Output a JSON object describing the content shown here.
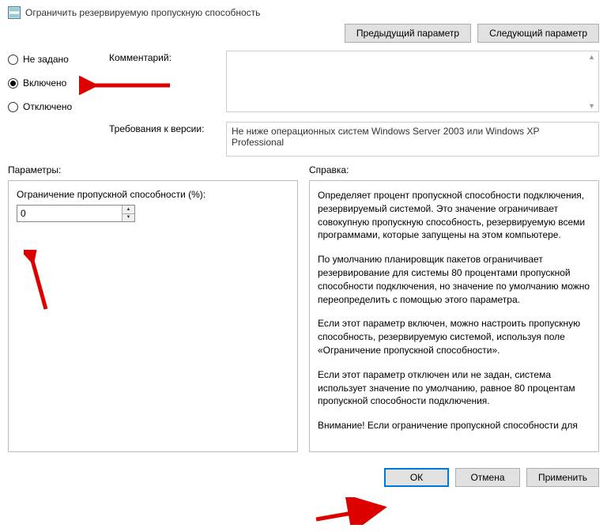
{
  "title": "Ограничить резервируемую пропускную способность",
  "nav": {
    "prev": "Предыдущий параметр",
    "next": "Следующий параметр"
  },
  "radios": {
    "not_configured": "Не задано",
    "enabled": "Включено",
    "disabled": "Отключено",
    "selected": "enabled"
  },
  "comment_label": "Комментарий:",
  "requirements_label": "Требования к версии:",
  "requirements_text": "Не ниже операционных систем Windows Server 2003 или Windows XP Professional",
  "options_label": "Параметры:",
  "help_label": "Справка:",
  "bandwidth_label": "Ограничение пропускной способности (%):",
  "bandwidth_value": "0",
  "help_paragraphs": [
    "Определяет процент пропускной способности подключения, резервируемый системой. Это значение ограничивает совокупную пропускную способность, резервируемую всеми программами, которые запущены на этом компьютере.",
    "По умолчанию планировщик пакетов ограничивает резервирование для системы 80 процентами пропускной способности подключения, но значение по умолчанию можно переопределить с помощью этого параметра.",
    "Если этот параметр включен, можно настроить пропускную способность, резервируемую системой, используя поле «Ограничение пропускной способности».",
    "Если этот параметр отключен или не задан, система использует значение по умолчанию, равное 80 процентам пропускной способности подключения.",
    "Внимание! Если ограничение пропускной способности для"
  ],
  "buttons": {
    "ok": "ОК",
    "cancel": "Отмена",
    "apply": "Применить"
  }
}
